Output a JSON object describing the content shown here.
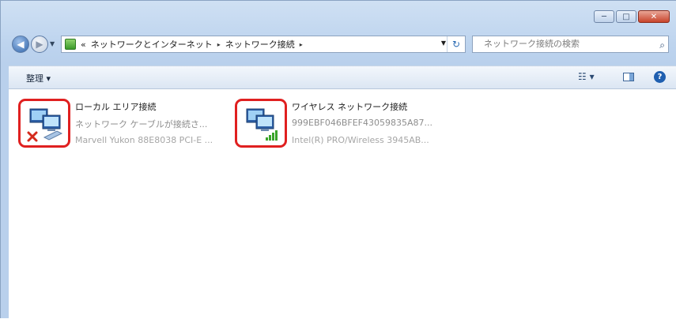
{
  "window": {
    "caption_buttons": {
      "minimize": "─",
      "maximize": "□",
      "close": "✕"
    }
  },
  "nav": {
    "back_glyph": "◀",
    "forward_glyph": "▶",
    "dropdown_glyph": "▼",
    "address_prefix": "«",
    "breadcrumbs": [
      "ネットワークとインターネット",
      "ネットワーク接続"
    ],
    "separator": "▸",
    "refresh_glyph": "↻",
    "search_placeholder": "ネットワーク接続の検索",
    "search_glyph": "⌕"
  },
  "toolbar": {
    "organize_label": "整理 ▾",
    "view_glyph": "☷ ▾",
    "help_glyph": "?"
  },
  "connections": [
    {
      "name": "ローカル エリア接続",
      "status": "ネットワーク ケーブルが接続さ...",
      "device": "Marvell Yukon 88E8038 PCI-E ...",
      "icon": "wired-disconnected-icon"
    },
    {
      "name": "ワイヤレス ネットワーク接続",
      "status": "999EBF046BFEF43059835A87...",
      "device": "Intel(R) PRO/Wireless 3945AB...",
      "icon": "wireless-connected-icon"
    }
  ],
  "colors": {
    "highlight_border": "#e02020",
    "error_x": "#d42a1c",
    "signal_green": "#3aa42a"
  }
}
